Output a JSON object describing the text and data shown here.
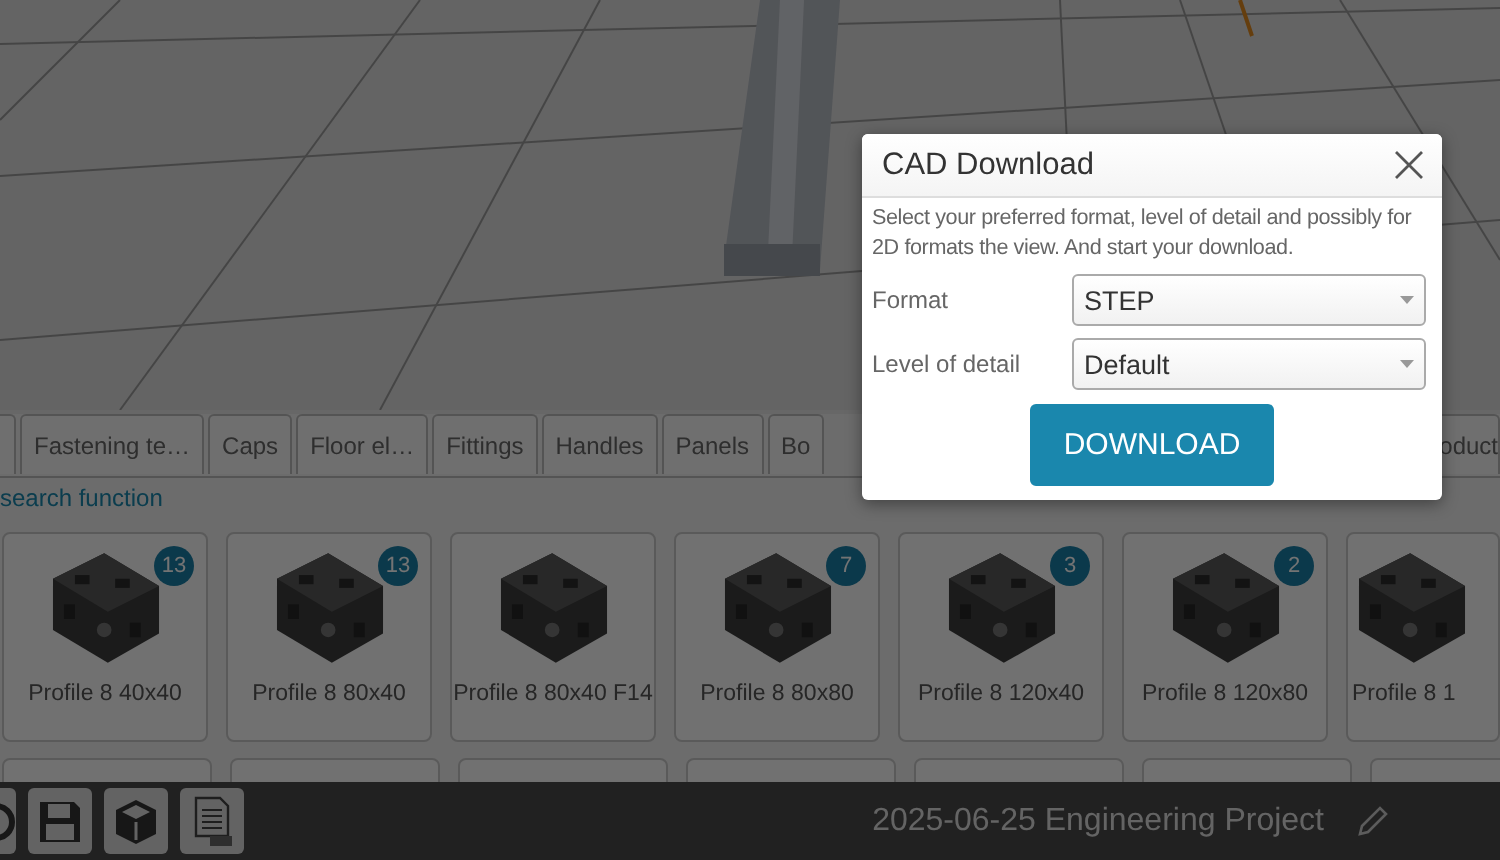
{
  "tabs": [
    {
      "label": "Fastening te…"
    },
    {
      "label": "Caps"
    },
    {
      "label": "Floor el…"
    },
    {
      "label": "Fittings"
    },
    {
      "label": "Handles"
    },
    {
      "label": "Panels"
    },
    {
      "label": "Bo"
    },
    {
      "label": "oduct"
    }
  ],
  "search_link": "search function",
  "cards": [
    {
      "label": "Profile 8 40x40",
      "count": "13"
    },
    {
      "label": "Profile 8 80x40",
      "count": "13"
    },
    {
      "label": "Profile 8 80x40 F14"
    },
    {
      "label": "Profile 8 80x80",
      "count": "7"
    },
    {
      "label": "Profile 8 120x40",
      "count": "3"
    },
    {
      "label": "Profile 8 120x80",
      "count": "2"
    },
    {
      "label": "Profile 8 1"
    }
  ],
  "project_title": "2025-06-25 Engineering Project",
  "dialog": {
    "title": "CAD Download",
    "description": "Select your preferred format, level of detail and possibly for 2D formats the view. And start your download.",
    "fields": [
      {
        "label": "Format",
        "value": "STEP"
      },
      {
        "label": "Level of detail",
        "value": "Default"
      }
    ],
    "button": "DOWNLOAD"
  }
}
